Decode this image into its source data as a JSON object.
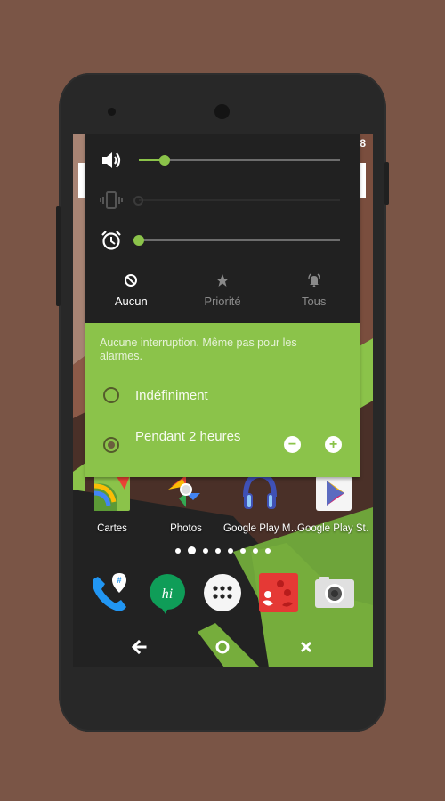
{
  "status_bar": {
    "time_fragment": "8"
  },
  "volume_panel": {
    "sliders": [
      {
        "name": "media",
        "icon": "speaker-icon",
        "value_fraction": 0.13,
        "enabled": true
      },
      {
        "name": "ringer",
        "icon": "vibrate-icon",
        "value_fraction": 0.0,
        "enabled": false
      },
      {
        "name": "alarm",
        "icon": "alarm-clock-icon",
        "value_fraction": 0.0,
        "enabled": true
      }
    ],
    "modes": [
      {
        "label": "Aucun",
        "icon": "block-icon",
        "active": true
      },
      {
        "label": "Priorité",
        "icon": "star-icon",
        "active": false
      },
      {
        "label": "Tous",
        "icon": "bell-icon",
        "active": false
      }
    ]
  },
  "dnd_panel": {
    "description": "Aucune interruption. Même pas pour les alarmes.",
    "options": [
      {
        "label": "Indéfiniment",
        "checked": false
      },
      {
        "label": "Pendant 2 heures",
        "checked": true
      }
    ],
    "decrease_label": "−",
    "increase_label": "+"
  },
  "home": {
    "apps": [
      {
        "label": "Cartes",
        "icon": "maps-icon"
      },
      {
        "label": "Photos",
        "icon": "photos-icon"
      },
      {
        "label": "Google Play M…",
        "icon": "play-music-icon"
      },
      {
        "label": "Google Play St…",
        "icon": "play-store-icon"
      }
    ],
    "page_count": 8,
    "current_page": 2,
    "dock": [
      {
        "icon": "phone-icon"
      },
      {
        "icon": "hangouts-icon"
      },
      {
        "icon": "app-drawer-icon"
      },
      {
        "icon": "people-icon"
      },
      {
        "icon": "camera-icon"
      }
    ]
  },
  "nav_bar": {
    "back": "back-icon",
    "home": "home-icon",
    "close": "close-icon"
  },
  "colors": {
    "accent": "#8bc34a",
    "panel": "#212121",
    "background": "#7a5546"
  }
}
